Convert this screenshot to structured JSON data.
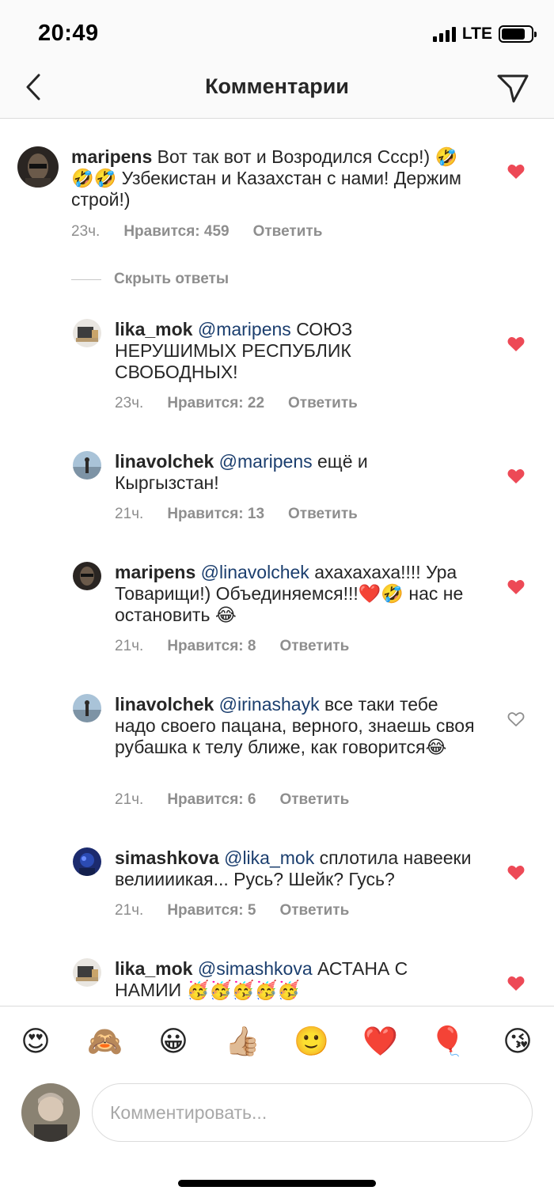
{
  "status_bar": {
    "time": "20:49",
    "network": "LTE",
    "signal_bars": 4,
    "battery_level": 0.8
  },
  "nav": {
    "title": "Комментарии",
    "back_icon": "chevron-left-icon",
    "share_icon": "paper-plane-icon"
  },
  "main_comment": {
    "username": "maripens",
    "text": "Вот так вот и Возродился Ссср!) 🤣🤣🤣 Узбекистан и Казахстан с нами! Держим строй!)",
    "time": "23ч.",
    "likes": "Нравится: 459",
    "reply_label": "Ответить",
    "liked": true
  },
  "hide_replies_label": "Скрыть ответы",
  "replies": [
    {
      "username": "lika_mok",
      "mention": "@maripens",
      "text": "СОЮЗ НЕРУШИМЫХ РЕСПУБЛИК СВОБОДНЫХ!",
      "time": "23ч.",
      "likes": "Нравится: 22",
      "reply_label": "Ответить",
      "liked": true
    },
    {
      "username": "linavolchek",
      "mention": "@maripens",
      "text": "ещё и Кыргызстан!",
      "time": "21ч.",
      "likes": "Нравится: 13",
      "reply_label": "Ответить",
      "liked": true
    },
    {
      "username": "maripens",
      "mention": "@linavolchek",
      "text": "ахахахаха!!!! Ура Товарищи!) Объединяемся!!!❤️🤣 нас не остановить 😂",
      "time": "21ч.",
      "likes": "Нравится: 8",
      "reply_label": "Ответить",
      "liked": true
    },
    {
      "username": "linavolchek",
      "mention": "@irinashayk",
      "text": "все таки тебе надо своего пацана, верного, знаешь своя рубашка к телу ближе, как говорится😂",
      "time": "21ч.",
      "likes": "Нравится: 6",
      "reply_label": "Ответить",
      "liked": false
    },
    {
      "username": "simashkova",
      "mention": "@lika_mok",
      "text": "сплотила навееки велиииикая... Русь? Шейк? Гусь?",
      "time": "21ч.",
      "likes": "Нравится: 5",
      "reply_label": "Ответить",
      "liked": true
    },
    {
      "username": "lika_mok",
      "mention": "@simashkova",
      "text": "АСТАНА С НАМИИ 🥳🥳🥳🥳🥳",
      "liked": true
    }
  ],
  "quick_emojis": [
    "😍",
    "🙈",
    "😀",
    "👍🏼",
    "🙂",
    "❤️",
    "🎈",
    "😘"
  ],
  "composer": {
    "placeholder": "Комментировать..."
  },
  "colors": {
    "heart_red": "#ed4956",
    "mention_blue": "#1b3e6e",
    "meta_gray": "#8e8e8e"
  }
}
